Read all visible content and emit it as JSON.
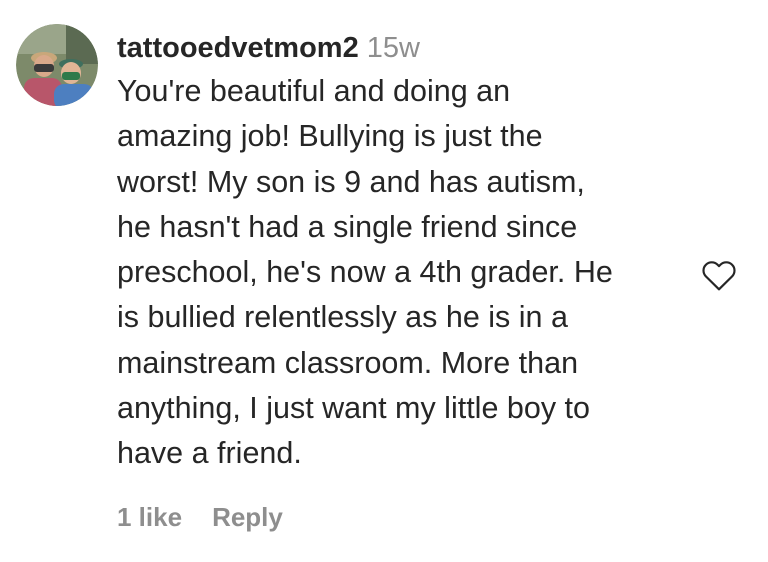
{
  "comment": {
    "author": {
      "username": "tattooedvetmom2",
      "avatar_icon": "user-avatar-photo"
    },
    "timestamp": "15w",
    "text_lines": [
      "You're beautiful and doing an",
      "amazing job! Bullying is just the",
      "worst! My son is 9 and has autism,",
      "he hasn't had a single friend since",
      "preschool, he's now a 4th grader. He",
      "is bullied relentlessly as he is in a",
      "mainstream classroom. More than",
      "anything, I just want my little boy to",
      "have a friend."
    ],
    "likes_label": "1 like",
    "reply_label": "Reply",
    "like_icon": "heart-outline-icon"
  },
  "colors": {
    "text": "#262626",
    "muted": "#8e8e8e",
    "background": "#ffffff"
  }
}
